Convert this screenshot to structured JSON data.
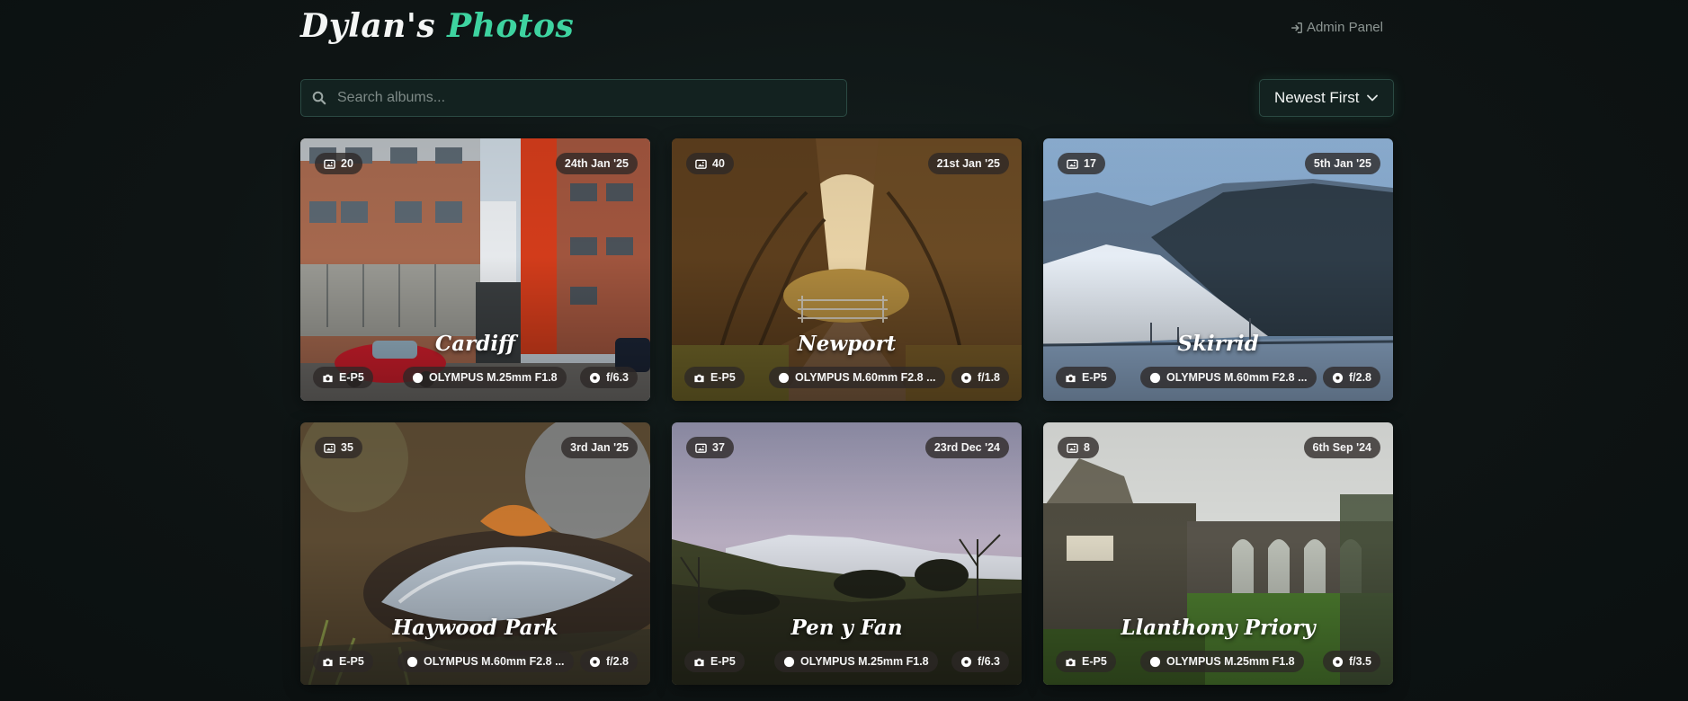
{
  "header": {
    "title_part1": "Dylan's",
    "title_part2": "Photos",
    "admin_label": "Admin Panel"
  },
  "search": {
    "placeholder": "Search albums...",
    "value": ""
  },
  "sort": {
    "selected": "Newest First"
  },
  "colors": {
    "accent": "#3ed3a0",
    "background": "#0e1414",
    "pill": "#2d2826"
  },
  "icons": {
    "admin": "sign-in-icon",
    "search": "search-icon",
    "sort": "chevron-down-icon",
    "count": "images-icon",
    "camera": "camera-icon",
    "lens": "lens-circle-icon",
    "aperture": "aperture-icon"
  },
  "albums": [
    {
      "title": "Cardiff",
      "count": "20",
      "date": "24th Jan '25",
      "camera": "E-P5",
      "lens": "OLYMPUS M.25mm F1.8",
      "aperture": "f/6.3"
    },
    {
      "title": "Newport",
      "count": "40",
      "date": "21st Jan '25",
      "camera": "E-P5",
      "lens": "OLYMPUS M.60mm F2.8 ...",
      "aperture": "f/1.8"
    },
    {
      "title": "Skirrid",
      "count": "17",
      "date": "5th Jan '25",
      "camera": "E-P5",
      "lens": "OLYMPUS M.60mm F2.8 ...",
      "aperture": "f/2.8"
    },
    {
      "title": "Haywood Park",
      "count": "35",
      "date": "3rd Jan '25",
      "camera": "E-P5",
      "lens": "OLYMPUS M.60mm F2.8 ...",
      "aperture": "f/2.8"
    },
    {
      "title": "Pen y Fan",
      "count": "37",
      "date": "23rd Dec '24",
      "camera": "E-P5",
      "lens": "OLYMPUS M.25mm F1.8",
      "aperture": "f/6.3"
    },
    {
      "title": "Llanthony Priory",
      "count": "8",
      "date": "6th Sep '24",
      "camera": "E-P5",
      "lens": "OLYMPUS M.25mm F1.8",
      "aperture": "f/3.5"
    }
  ]
}
